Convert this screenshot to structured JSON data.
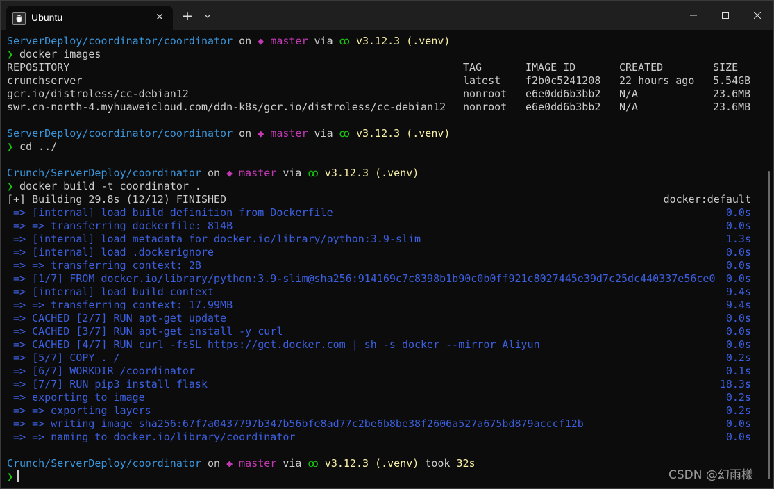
{
  "window": {
    "tab_title": "Ubuntu",
    "new_tab_label": "+",
    "close_tab_label": "✕"
  },
  "prompts": [
    {
      "path": "ServerDeploy/coordinator/coordinator",
      "on": " on ",
      "branch_icon": "◆",
      "branch": " master",
      "via": " via ",
      "py_icon": "ꝏ",
      "py": " v3.12.3 (.venv)",
      "took": "",
      "duration": ""
    },
    {
      "path": "ServerDeploy/coordinator/coordinator",
      "on": " on ",
      "branch_icon": "◆",
      "branch": " master",
      "via": " via ",
      "py_icon": "ꝏ",
      "py": " v3.12.3 (.venv)",
      "took": "",
      "duration": ""
    },
    {
      "path": "Crunch/ServerDeploy/coordinator",
      "on": " on ",
      "branch_icon": "◆",
      "branch": " master",
      "via": " via ",
      "py_icon": "ꝏ",
      "py": " v3.12.3 (.venv)",
      "took": "",
      "duration": ""
    },
    {
      "path": "Crunch/ServerDeploy/coordinator",
      "on": " on ",
      "branch_icon": "◆",
      "branch": " master",
      "via": " via ",
      "py_icon": "ꝏ",
      "py": " v3.12.3 (.venv)",
      "took": " took ",
      "duration": "32s"
    }
  ],
  "commands": {
    "prompt_char": "❯",
    "cmd1": " docker images",
    "cmd2": " cd ../",
    "cmd3": " docker build -t coordinator ."
  },
  "images_table": {
    "headers": [
      "REPOSITORY",
      "TAG",
      "IMAGE ID",
      "CREATED",
      "SIZE"
    ],
    "rows": [
      [
        "crunchserver",
        "latest",
        "f2b0c5241208",
        "22 hours ago",
        "5.54GB"
      ],
      [
        "gcr.io/distroless/cc-debian12",
        "nonroot",
        "e6e0dd6b3bb2",
        "N/A",
        "23.6MB"
      ],
      [
        "swr.cn-north-4.myhuaweicloud.com/ddn-k8s/gcr.io/distroless/cc-debian12",
        "nonroot",
        "e6e0dd6b3bb2",
        "N/A",
        "23.6MB"
      ]
    ]
  },
  "build": {
    "status": "[+] Building 29.8s (12/12) FINISHED",
    "builder": "docker:default",
    "steps": [
      {
        "text": " => [internal] load build definition from Dockerfile",
        "time": "0.0s"
      },
      {
        "text": " => => transferring dockerfile: 814B",
        "time": "0.0s"
      },
      {
        "text": " => [internal] load metadata for docker.io/library/python:3.9-slim",
        "time": "1.3s"
      },
      {
        "text": " => [internal] load .dockerignore",
        "time": "0.0s"
      },
      {
        "text": " => => transferring context: 2B",
        "time": "0.0s"
      },
      {
        "text": " => [1/7] FROM docker.io/library/python:3.9-slim@sha256:914169c7c8398b1b90c0b0ff921c8027445e39d7c25dc440337e56ce0",
        "time": "0.0s"
      },
      {
        "text": " => [internal] load build context",
        "time": "9.4s"
      },
      {
        "text": " => => transferring context: 17.99MB",
        "time": "9.4s"
      },
      {
        "text": " => CACHED [2/7] RUN apt-get update",
        "time": "0.0s"
      },
      {
        "text": " => CACHED [3/7] RUN apt-get install -y curl",
        "time": "0.0s"
      },
      {
        "text": " => CACHED [4/7] RUN curl -fsSL https://get.docker.com | sh -s docker --mirror Aliyun",
        "time": "0.0s"
      },
      {
        "text": " => [5/7] COPY . /",
        "time": "0.2s"
      },
      {
        "text": " => [6/7] WORKDIR /coordinator",
        "time": "0.1s"
      },
      {
        "text": " => [7/7] RUN pip3 install flask",
        "time": "18.3s"
      },
      {
        "text": " => exporting to image",
        "time": "0.2s"
      },
      {
        "text": " => => exporting layers",
        "time": "0.2s"
      },
      {
        "text": " => => writing image sha256:67f7a0437797b347b56bfe8ad77c2be6b8be38f2606a527a675bd879acccf12b",
        "time": "0.0s"
      },
      {
        "text": " => => naming to docker.io/library/coordinator",
        "time": "0.0s"
      }
    ]
  },
  "watermark": "CSDN @幻雨樣",
  "colors": {
    "path": "#3a96dd",
    "branch": "#c239b3",
    "python": "#f9f1a5",
    "prompt": "#16c60c",
    "build_step": "#0037da",
    "text": "#cccccc",
    "background": "#0c0c0c"
  }
}
